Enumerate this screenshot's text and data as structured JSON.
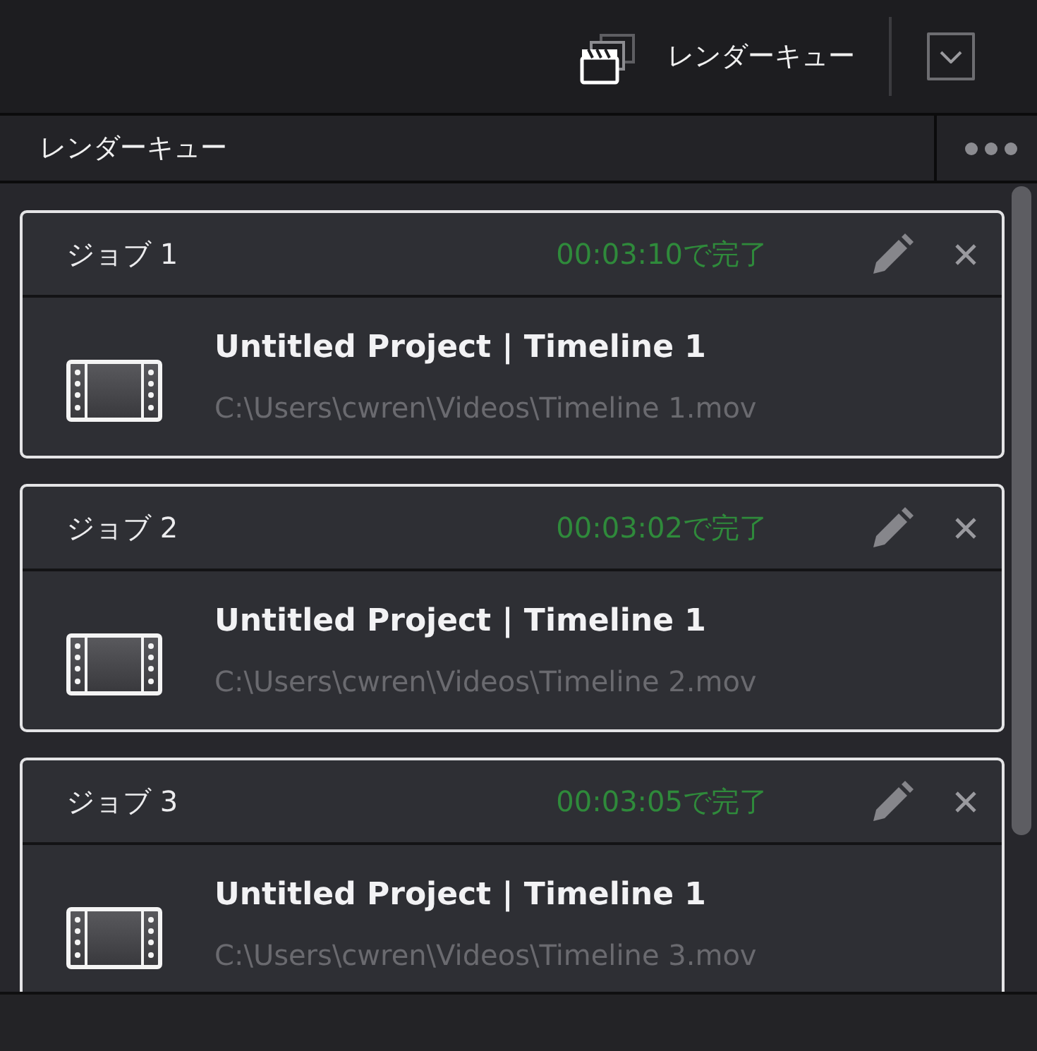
{
  "top_bar": {
    "title": "レンダーキュー"
  },
  "panel": {
    "title": "レンダーキュー"
  },
  "jobs": [
    {
      "name": "ジョブ 1",
      "status": "00:03:10で完了",
      "title": "Untitled Project | Timeline 1",
      "path": "C:\\Users\\cwren\\Videos\\Timeline 1.mov"
    },
    {
      "name": "ジョブ 2",
      "status": "00:03:02で完了",
      "title": "Untitled Project | Timeline 1",
      "path": "C:\\Users\\cwren\\Videos\\Timeline 2.mov"
    },
    {
      "name": "ジョブ 3",
      "status": "00:03:05で完了",
      "title": "Untitled Project | Timeline 1",
      "path": "C:\\Users\\cwren\\Videos\\Timeline 3.mov"
    }
  ]
}
